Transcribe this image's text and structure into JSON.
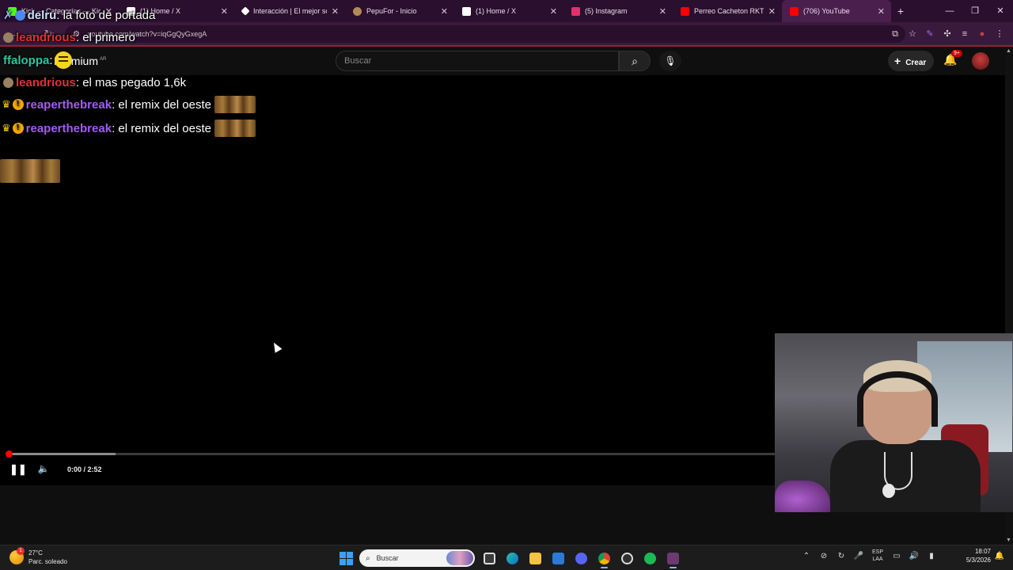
{
  "browser": {
    "tabs": [
      {
        "title": "Kick — Categorías — Kick",
        "icon_color": "#53fc18",
        "active": false,
        "close": "✕"
      },
      {
        "title": "(1) Home / X",
        "icon_color": "#ffffff",
        "active": false,
        "close": "✕"
      },
      {
        "title": "Interacción | El mejor software",
        "icon_color": "#ffffff",
        "active": false,
        "close": "✕"
      },
      {
        "title": "PepuFor - Inicio",
        "icon_color": "#b08a5a",
        "active": false,
        "close": "✕"
      },
      {
        "title": "(1) Home / X",
        "icon_color": "#ffffff",
        "active": false,
        "close": "✕"
      },
      {
        "title": "(5) Instagram",
        "icon_color": "#e1306c",
        "active": false,
        "close": "✕"
      },
      {
        "title": "Perreo Cacheton RKT - DJ",
        "icon_color": "#ff0000",
        "active": false,
        "close": "✕"
      },
      {
        "title": "(706) YouTube",
        "icon_color": "#ff0000",
        "active": true,
        "close": "✕"
      }
    ],
    "new_tab": "+",
    "window_controls": {
      "minimize": "—",
      "maximize": "❐",
      "close": "✕"
    },
    "url": "youtube.com/watch?v=iqGgQyGxegA",
    "nav": {
      "back": "←",
      "forward": "→",
      "reload": "↻"
    }
  },
  "youtube": {
    "logo_text": "Premium",
    "logo_region": "AR",
    "search_placeholder": "Buscar",
    "create_label": "Crear",
    "notif_badge": "9+",
    "player": {
      "current_time": "0:00",
      "duration": "2:52",
      "time_sep": " / ",
      "progress_fraction": 0.0,
      "buffered_fraction": 0.14
    }
  },
  "chat": {
    "overlay_title_user": "delru",
    "overlay_title_msg": ": la foto de portada",
    "lines": [
      {
        "user": "leandrious",
        "user_color": "#e0303a",
        "msg": ": el primero"
      },
      {
        "user": "ffaloppa",
        "user_color": "#29c7a0",
        "msg": ":"
      },
      {
        "user": "leandrious",
        "user_color": "#e0303a",
        "msg": ": el mas pegado 1,6k"
      },
      {
        "user": "reaperthebreak",
        "user_color": "#a45cf0",
        "msg": ": el remix del oeste"
      },
      {
        "user": "reaperthebreak",
        "user_color": "#a45cf0",
        "msg": ": el remix del oeste"
      }
    ]
  },
  "taskbar": {
    "weather_temp": "27°C",
    "weather_desc": "Parc. soleado",
    "weather_badge": "1",
    "search_label": "Buscar",
    "lang_top": "ESP",
    "lang_bottom": "LAA",
    "time": "18:07",
    "date": "5/3/2026"
  }
}
